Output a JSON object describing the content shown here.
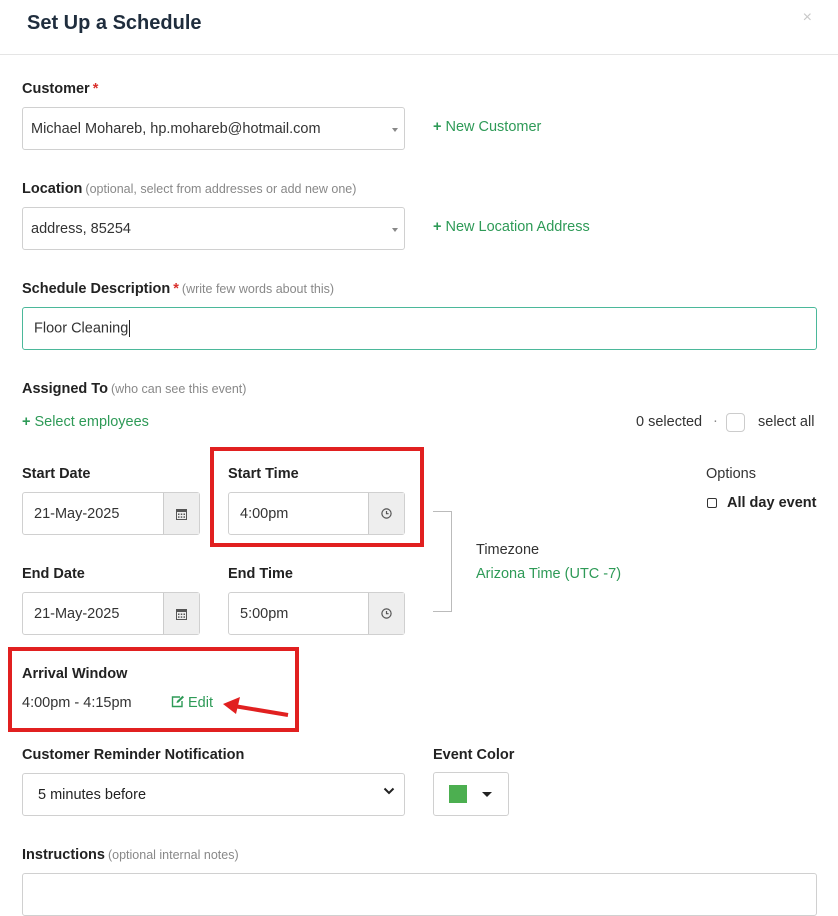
{
  "dialog": {
    "title": "Set Up a Schedule",
    "close": "×"
  },
  "customer": {
    "label": "Customer",
    "required": "*",
    "value": "Michael Mohareb, hp.mohareb@hotmail.com",
    "new_link": "New Customer"
  },
  "location": {
    "label": "Location",
    "hint": "(optional, select from addresses or add new one)",
    "value": "address, 85254",
    "new_link": "New Location Address"
  },
  "description": {
    "label": "Schedule Description",
    "required": "*",
    "hint": "(write few words about this)",
    "value": "Floor Cleaning"
  },
  "assigned": {
    "label": "Assigned To",
    "hint": "(who can see this event)",
    "select_link": "Select employees",
    "selected_count": "0 selected",
    "separator": "·",
    "select_all": "select all"
  },
  "start_date": {
    "label": "Start Date",
    "value": "21-May-2025"
  },
  "start_time": {
    "label": "Start Time",
    "value": "4:00pm"
  },
  "end_date": {
    "label": "End Date",
    "value": "21-May-2025"
  },
  "end_time": {
    "label": "End Time",
    "value": "5:00pm"
  },
  "options": {
    "label": "Options",
    "all_day": "All day event"
  },
  "timezone": {
    "label": "Timezone",
    "value": "Arizona Time (UTC -7)"
  },
  "arrival": {
    "label": "Arrival Window",
    "value": "4:00pm - 4:15pm",
    "edit": "Edit"
  },
  "reminder": {
    "label": "Customer Reminder Notification",
    "value": "5 minutes before"
  },
  "event_color": {
    "label": "Event Color",
    "color": "#4caf50"
  },
  "instructions": {
    "label": "Instructions",
    "hint": "(optional internal notes)"
  },
  "annotation": {
    "highlight_color": "#e12020"
  }
}
